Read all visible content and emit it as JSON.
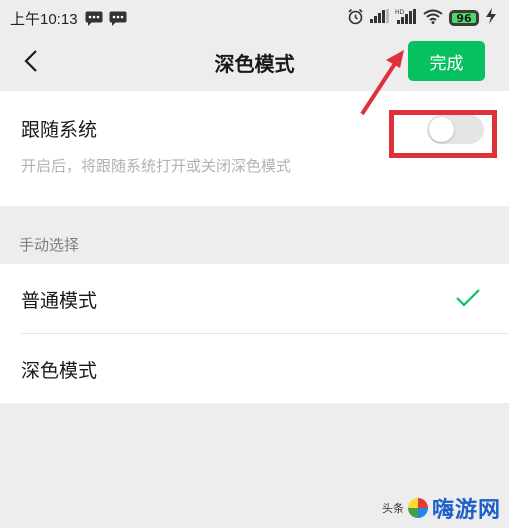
{
  "status_bar": {
    "time": "上午10:13",
    "battery": "96",
    "icons": [
      "chat-icon",
      "chat-icon",
      "alarm-icon",
      "signal-icon",
      "hd-signal-icon",
      "wifi-icon",
      "battery-icon",
      "charging-icon"
    ]
  },
  "nav": {
    "title": "深色模式",
    "done_label": "完成",
    "back_icon": "chevron-left-icon"
  },
  "follow_system": {
    "title": "跟随系统",
    "description": "开启后，将跟随系统打开或关闭深色模式",
    "toggle_on": false
  },
  "manual": {
    "group_label": "手动选择",
    "options": [
      {
        "label": "普通模式",
        "selected": true
      },
      {
        "label": "深色模式",
        "selected": false
      }
    ]
  },
  "watermark": {
    "prefix": "头条",
    "brand": "嗨游网"
  },
  "colors": {
    "accent": "#07c160",
    "annotation": "#e0303a",
    "background": "#ededed"
  }
}
